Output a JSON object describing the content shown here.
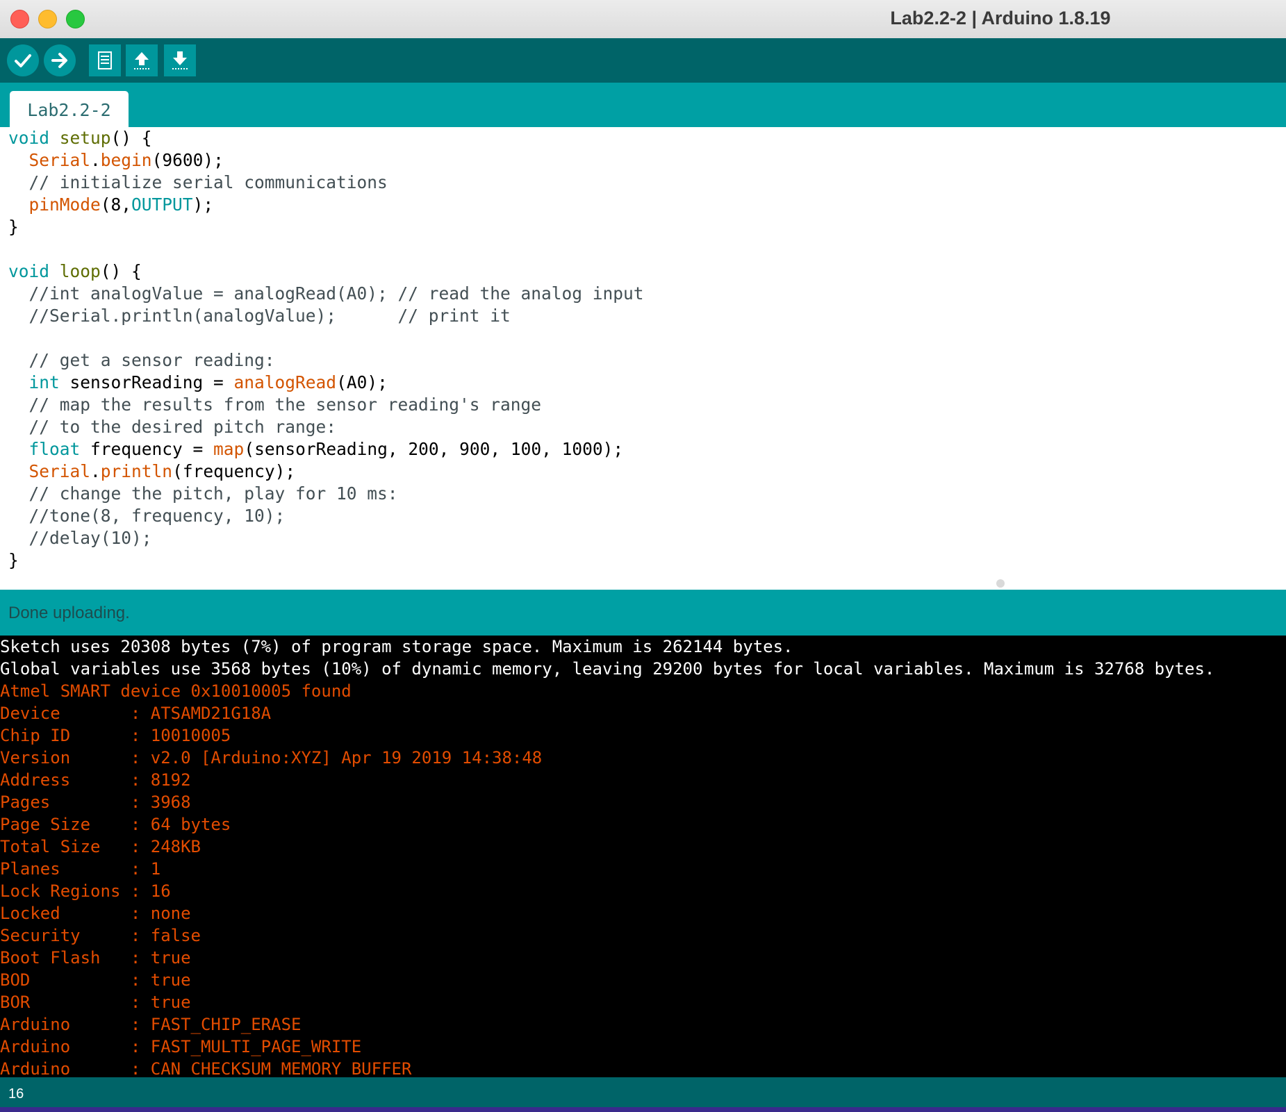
{
  "window": {
    "title": "Lab2.2-2 | Arduino 1.8.19"
  },
  "toolbar": {
    "verify": "verify-icon",
    "upload": "upload-arrow-icon",
    "new": "new-file-icon",
    "open": "open-icon",
    "save": "save-icon"
  },
  "tabs": [
    {
      "label": "Lab2.2-2"
    }
  ],
  "status": {
    "message": "Done uploading."
  },
  "console": {
    "lines": [
      {
        "text": "Sketch uses 20308 bytes (7%) of program storage space. Maximum is 262144 bytes.",
        "color": "white"
      },
      {
        "text": "Global variables use 3568 bytes (10%) of dynamic memory, leaving 29200 bytes for local variables. Maximum is 32768 bytes.",
        "color": "white"
      },
      {
        "text": "Atmel SMART device 0x10010005 found",
        "color": "orange"
      },
      {
        "text": "Device       : ATSAMD21G18A",
        "color": "orange"
      },
      {
        "text": "Chip ID      : 10010005",
        "color": "orange"
      },
      {
        "text": "Version      : v2.0 [Arduino:XYZ] Apr 19 2019 14:38:48",
        "color": "orange"
      },
      {
        "text": "Address      : 8192",
        "color": "orange"
      },
      {
        "text": "Pages        : 3968",
        "color": "orange"
      },
      {
        "text": "Page Size    : 64 bytes",
        "color": "orange"
      },
      {
        "text": "Total Size   : 248KB",
        "color": "orange"
      },
      {
        "text": "Planes       : 1",
        "color": "orange"
      },
      {
        "text": "Lock Regions : 16",
        "color": "orange"
      },
      {
        "text": "Locked       : none",
        "color": "orange"
      },
      {
        "text": "Security     : false",
        "color": "orange"
      },
      {
        "text": "Boot Flash   : true",
        "color": "orange"
      },
      {
        "text": "BOD          : true",
        "color": "orange"
      },
      {
        "text": "BOR          : true",
        "color": "orange"
      },
      {
        "text": "Arduino      : FAST_CHIP_ERASE",
        "color": "orange"
      },
      {
        "text": "Arduino      : FAST_MULTI_PAGE_WRITE",
        "color": "orange"
      },
      {
        "text": "Arduino      : CAN_CHECKSUM_MEMORY_BUFFER",
        "color": "orange"
      }
    ]
  },
  "footer": {
    "line_number": "16"
  },
  "colors": {
    "toolbar": "#006468",
    "tabbar": "#00a0a4",
    "console_orange": "#e34c00"
  }
}
